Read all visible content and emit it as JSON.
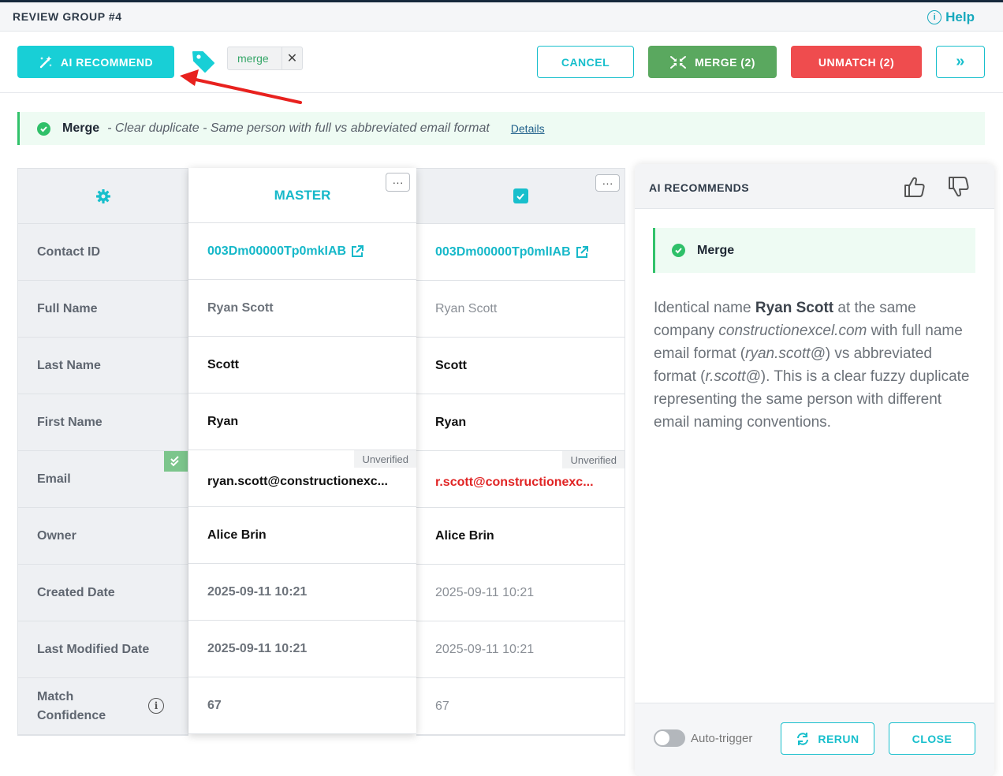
{
  "header": {
    "title": "REVIEW GROUP #4",
    "help_label": "Help",
    "help_icon": "info-icon"
  },
  "toolbar": {
    "ai_recommend_label": "AI RECOMMEND",
    "tag_chip": "merge",
    "tag_remove": "✕",
    "cancel_label": "CANCEL",
    "merge_label": "MERGE (2)",
    "unmatch_label": "UNMATCH (2)",
    "next_label": "»"
  },
  "banner": {
    "title": "Merge",
    "description": "- Clear duplicate - Same person with full vs abbreviated email format",
    "details_label": "Details"
  },
  "table": {
    "master_label": "MASTER",
    "menu_glyph": "···",
    "info_glyph": "i",
    "rows": [
      {
        "label": "Contact ID",
        "master": "003Dm00000Tp0mkIAB",
        "other": "003Dm00000Tp0mlIAB"
      },
      {
        "label": "Full Name",
        "master": "Ryan Scott",
        "other": "Ryan Scott"
      },
      {
        "label": "Last Name",
        "master": "Scott",
        "other": "Scott"
      },
      {
        "label": "First Name",
        "master": "Ryan",
        "other": "Ryan"
      },
      {
        "label": "Email",
        "master": "ryan.scott@constructionexc...",
        "other": "r.scott@constructionexc...",
        "badge": "Unverified"
      },
      {
        "label": "Owner",
        "master": "Alice Brin",
        "other": "Alice Brin"
      },
      {
        "label": "Created Date",
        "master": "2025-09-11 10:21",
        "other": "2025-09-11 10:21"
      },
      {
        "label": "Last Modified Date",
        "master": "2025-09-11 10:21",
        "other": "2025-09-11 10:21"
      },
      {
        "label": "Match Confidence",
        "master": "67",
        "other": "67"
      }
    ]
  },
  "panel": {
    "title": "AI RECOMMENDS",
    "recommendation": "Merge",
    "text_1": "Identical name ",
    "name": "Ryan Scott",
    "text_2": " at the same company ",
    "company": "constructionexcel.com",
    "text_3": " with full name email format (",
    "email_full": "ryan.scott@",
    "text_4": ") vs abbreviated format (",
    "email_short": "r.scott@",
    "text_5": "). This is a clear fuzzy duplicate representing the same person with different email naming conventions.",
    "auto_trigger_label": "Auto-trigger",
    "rerun_label": "RERUN",
    "close_label": "CLOSE"
  },
  "colors": {
    "accent": "#18cfd6",
    "merge": "#5aa85f",
    "unmatch": "#ef4c4e",
    "success": "#2fc069",
    "annotation_arrow": "#e8211e"
  }
}
